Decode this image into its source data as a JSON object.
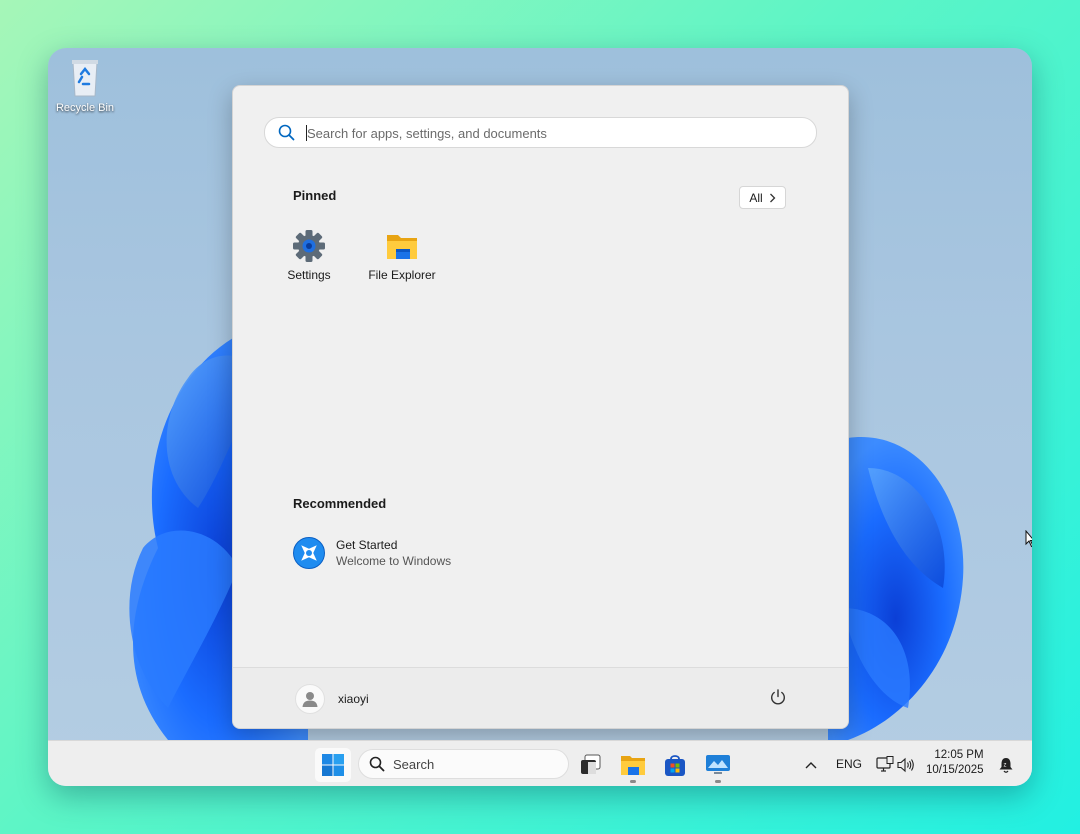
{
  "desktop": {
    "recycle_bin_label": "Recycle Bin"
  },
  "start_menu": {
    "search_placeholder": "Search for apps, settings, and documents",
    "pinned_title": "Pinned",
    "all_button_label": "All",
    "pinned_apps": [
      {
        "label": "Settings",
        "icon": "settings-gear-icon"
      },
      {
        "label": "File Explorer",
        "icon": "file-explorer-icon"
      }
    ],
    "recommended_title": "Recommended",
    "recommended": [
      {
        "title": "Get Started",
        "subtitle": "Welcome to Windows",
        "icon": "get-started-icon"
      }
    ],
    "user_name": "xiaoyi"
  },
  "taskbar": {
    "search_label": "Search",
    "language": "ENG",
    "time": "12:05 PM",
    "date": "10/15/2025"
  },
  "colors": {
    "accent": "#0067c0",
    "start_bg": "#f0f0f0",
    "taskbar_bg": "#eeeeee"
  }
}
